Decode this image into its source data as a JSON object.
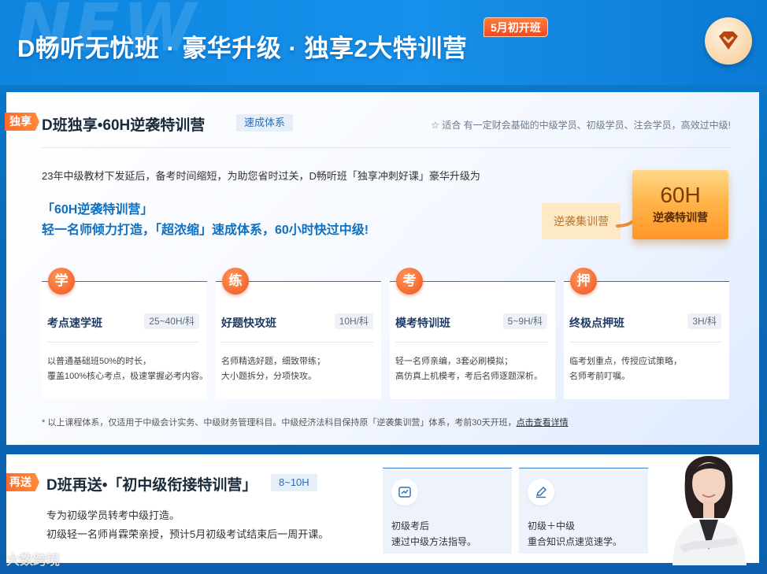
{
  "header": {
    "bg_text": "NEW",
    "title": "D畅听无忧班 · 豪华升级 · 独享2大特训营",
    "badge": "5月初开班",
    "logo_icon": "diamond-heart-icon"
  },
  "section1": {
    "tag": "独享",
    "title": "D班独享•60H逆袭特训营",
    "chip": "速成体系",
    "suitable_note": "☆ 适合 有一定财会基础的中级学员、初级学员、注会学员，高效过中级!",
    "intro": "23年中级教材下发延后，备考时间缩短，为助您省时过关，D畅听班「独享冲刺好课」豪华升级为",
    "highlight1": "「60H逆袭特训营」",
    "highlight2": "轻一名师倾力打造，「超浓缩」速成体系，60小时快过中级!",
    "camp_old": "逆袭集训营",
    "camp_new_big": "60H",
    "camp_new_small": "逆袭特训营",
    "courses": [
      {
        "badge": "学",
        "name": "考点速学班",
        "hours": "25~40H/科",
        "desc1": "以普通基础班50%的时长，",
        "desc2": "覆盖100%核心考点，极速掌握必考内容。"
      },
      {
        "badge": "练",
        "name": "好题快攻班",
        "hours": "10H/科",
        "desc1": "名师精选好题，细致带练；",
        "desc2": "大小题拆分，分项快攻。"
      },
      {
        "badge": "考",
        "name": "模考特训班",
        "hours": "5~9H/科",
        "desc1": "轻一名师亲编，3套必刷模拟；",
        "desc2": "高仿真上机模考，考后名师逐题深析。"
      },
      {
        "badge": "押",
        "name": "终极点押班",
        "hours": "3H/科",
        "desc1": "临考划重点，传授应试策略，",
        "desc2": "名师考前叮嘱。"
      }
    ],
    "footnote": "* 以上课程体系，仅适用于中级会计实务、中级财务管理科目。中级经济法科目保持原「逆袭集训营」体系，考前30天开班，",
    "footnote_link": "点击查看详情"
  },
  "section2": {
    "tag": "再送",
    "title": "D班再送•「初中级衔接特训营」",
    "chip": "8~10H",
    "line1": "专为初级学员转考中级打造。",
    "line2": "初级轻一名师肖霖荣亲授，预计5月初级考试结束后一周开课。",
    "cards": [
      {
        "icon": "chart-icon",
        "t1": "初级考后",
        "t2": "速过中级方法指导。"
      },
      {
        "icon": "pen-icon",
        "t1": "初级＋中级",
        "t2": "重合知识点速览速学。"
      }
    ]
  },
  "watermark": "大数跨境",
  "colors": {
    "accent": "#0f6fc0",
    "tag": "#ff6a2b",
    "header": "#0e86e0"
  }
}
